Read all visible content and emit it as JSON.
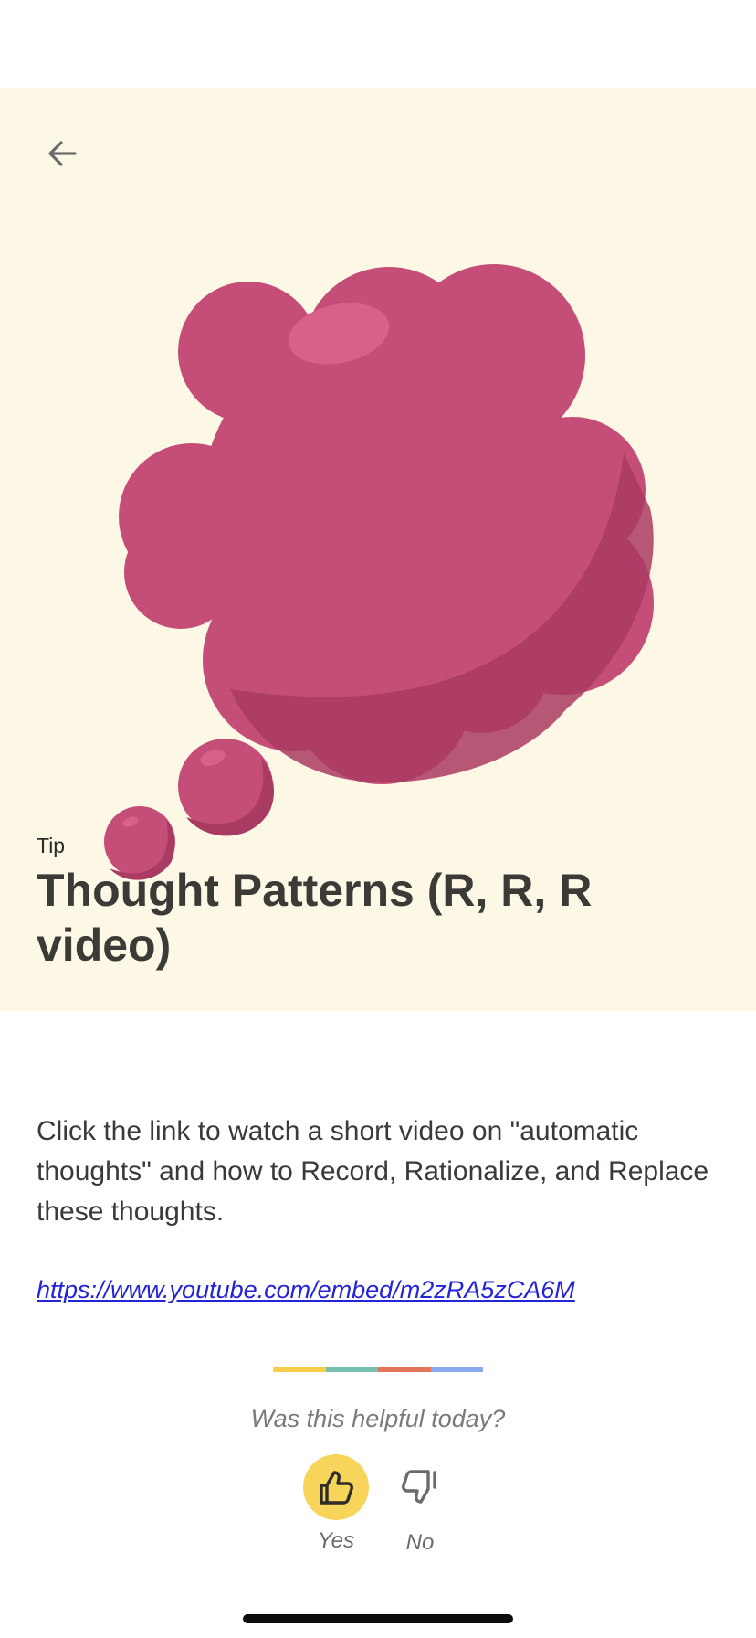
{
  "header": {
    "back_icon": "arrow-left-icon",
    "back_icon_color": "#6b6b6b"
  },
  "hero": {
    "background_color": "#fdf7e6",
    "illustration": "thought-bubble-illustration",
    "illustration_color": "#c44e77",
    "category": "Tip",
    "title": "Thought Patterns (R, R, R video)"
  },
  "content": {
    "body": "Click the link to watch a short video on \"automatic thoughts\" and how to Record, Rationalize, and Replace these thoughts.",
    "link_text": "https://www.youtube.com/embed/m2zRA5zCA6M",
    "link_color": "#2323d8"
  },
  "divider_colors": [
    "#f5cf4a",
    "#78c0b0",
    "#e5735a",
    "#88aaf0"
  ],
  "feedback": {
    "question": "Was this helpful today?",
    "yes_label": "Yes",
    "no_label": "No",
    "yes_icon": "thumbs-up-icon",
    "no_icon": "thumbs-down-icon",
    "yes_active_color": "#f7d55b"
  }
}
